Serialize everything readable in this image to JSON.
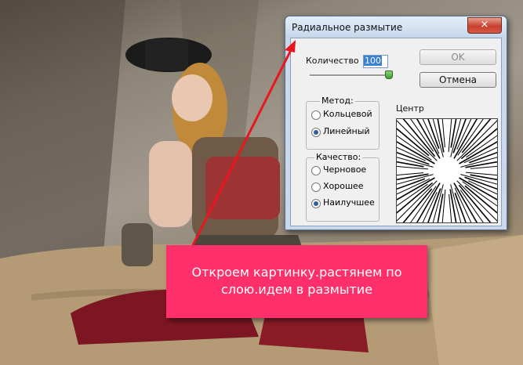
{
  "dialog": {
    "title": "Радиальное размытие",
    "close_icon": "×",
    "amount_label": "Количество",
    "amount_value": "100",
    "amount_slider_fraction": 1.0,
    "ok_label": "OK",
    "cancel_label": "Отмена",
    "method": {
      "title": "Метод:",
      "options": [
        "Кольцевой",
        "Линейный"
      ],
      "selected": "Линейный"
    },
    "quality": {
      "title": "Качество:",
      "options": [
        "Черновое",
        "Хорошее",
        "Наилучшее"
      ],
      "selected": "Наилучшее"
    },
    "center_label": "Центр"
  },
  "banner": {
    "text": "Откроем картинку.растянем по\nслою.идем в размытие",
    "color": "#ff2f6b"
  },
  "arrow_color": "#e8161f"
}
